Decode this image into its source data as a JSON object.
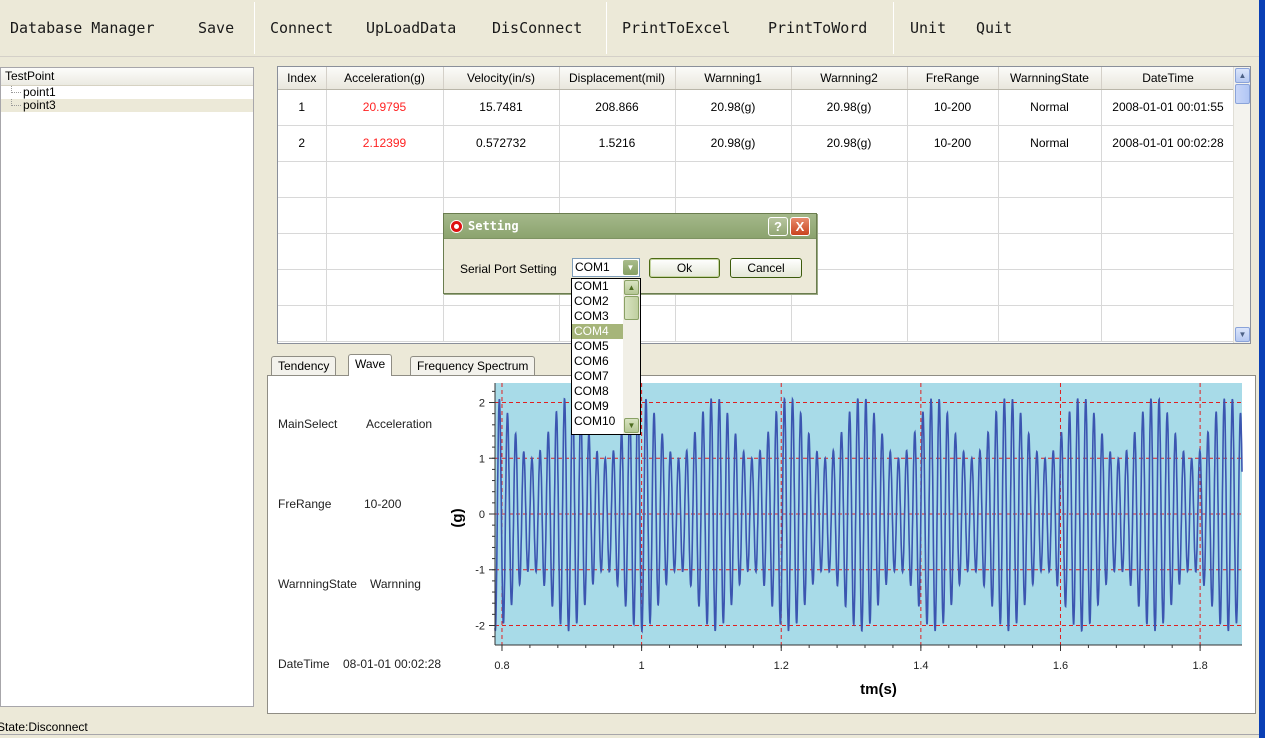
{
  "menu": [
    "Database Manager",
    "Save",
    "Connect",
    "UpLoadData",
    "DisConnect",
    "PrintToExcel",
    "PrintToWord",
    "Unit",
    "Quit"
  ],
  "tree": {
    "header": "TestPoint",
    "items": [
      "point1",
      "point3"
    ]
  },
  "grid": {
    "columns": [
      "Index",
      "Acceleration(g)",
      "Velocity(in/s)",
      "Displacement(mil)",
      "Warnning1",
      "Warnning2",
      "FreRange",
      "WarnningState",
      "DateTime"
    ],
    "rows": [
      [
        "1",
        "20.9795",
        "15.7481",
        "208.866",
        "20.98(g)",
        "20.98(g)",
        "10-200",
        "Normal",
        "2008-01-01 00:01:55"
      ],
      [
        "2",
        "2.12399",
        "0.572732",
        "1.5216",
        "20.98(g)",
        "20.98(g)",
        "10-200",
        "Normal",
        "2008-01-01 00:02:28"
      ],
      [
        "",
        "",
        "",
        "",
        "",
        "",
        "",
        "",
        ""
      ],
      [
        "",
        "",
        "",
        "",
        "",
        "",
        "",
        "",
        ""
      ],
      [
        "",
        "",
        "",
        "",
        "",
        "",
        "",
        "",
        ""
      ],
      [
        "",
        "",
        "",
        "",
        "",
        "",
        "",
        "",
        ""
      ],
      [
        "",
        "",
        "",
        "",
        "",
        "",
        "",
        "",
        ""
      ]
    ],
    "accel_color": "#ff2222"
  },
  "tabs": [
    "Tendency",
    "Wave",
    "Frequency Spectrum"
  ],
  "active_tab": "Wave",
  "info": {
    "main_select_label": "MainSelect",
    "main_select_value": "Acceleration",
    "fre_range_label": "FreRange",
    "fre_range_value": "10-200",
    "warn_state_label": "WarnningState",
    "warn_state_value": "Warnning",
    "datetime_label": "DateTime",
    "datetime_value": "08-01-01 00:02:28"
  },
  "dialog": {
    "title": "Setting",
    "help": "?",
    "close": "X",
    "port_label": "Serial Port Setting",
    "port_value": "COM1",
    "ok": "Ok",
    "cancel": "Cancel",
    "port_options": [
      "COM1",
      "COM2",
      "COM3",
      "COM4",
      "COM5",
      "COM6",
      "COM7",
      "COM8",
      "COM9",
      "COM10"
    ],
    "highlighted_option": "COM4"
  },
  "status": "State:Disconnect",
  "chart_data": {
    "type": "line",
    "xlabel": "tm(s)",
    "ylabel": "(g)",
    "xlim": [
      0.79,
      1.86
    ],
    "ylim": [
      -2.35,
      2.35
    ],
    "xticks": [
      0.8,
      1,
      1.2,
      1.4,
      1.6,
      1.8
    ],
    "xtick_labels": [
      "0.8",
      "1",
      "1.2",
      "1.4",
      "1.6",
      "1.8"
    ],
    "yticks": [
      2,
      1,
      0,
      -1,
      -2
    ],
    "ytick_labels": [
      "2",
      "1",
      "0",
      "-1",
      "-2"
    ],
    "grid": true,
    "series": [
      {
        "signal": "sinusoid",
        "amplitude_min": 1.0,
        "amplitude_max": 2.1,
        "beat_period_s": 0.105,
        "cycles_per_beat": 9,
        "color": "#3b55b0"
      }
    ],
    "background": "#a8dbe8",
    "gridline_color": "#e02020"
  }
}
